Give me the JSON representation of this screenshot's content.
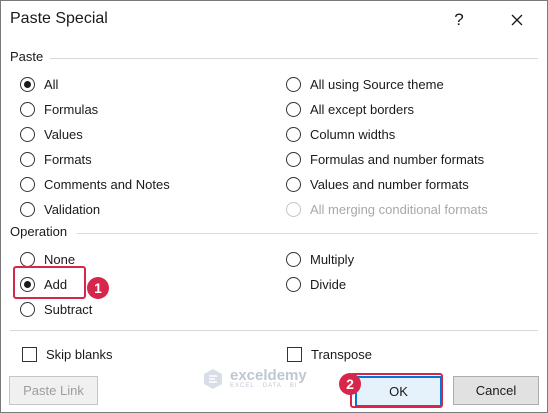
{
  "dialog": {
    "title": "Paste Special",
    "help_glyph": "?"
  },
  "paste": {
    "label": "Paste",
    "left": [
      {
        "label": "All",
        "checked": true
      },
      {
        "label": "Formulas"
      },
      {
        "label": "Values"
      },
      {
        "label": "Formats"
      },
      {
        "label": "Comments and Notes"
      },
      {
        "label": "Validation"
      }
    ],
    "right": [
      {
        "label": "All using Source theme"
      },
      {
        "label": "All except borders"
      },
      {
        "label": "Column widths"
      },
      {
        "label": "Formulas and number formats"
      },
      {
        "label": "Values and number formats"
      },
      {
        "label": "All merging conditional formats",
        "disabled": true
      }
    ]
  },
  "operation": {
    "label": "Operation",
    "left": [
      {
        "label": "None"
      },
      {
        "label": "Add",
        "checked": true
      },
      {
        "label": "Subtract"
      }
    ],
    "right": [
      {
        "label": "Multiply"
      },
      {
        "label": "Divide"
      }
    ]
  },
  "checkboxes": {
    "skip_blanks": "Skip blanks",
    "transpose": "Transpose"
  },
  "buttons": {
    "paste_link": "Paste Link",
    "ok": "OK",
    "cancel": "Cancel"
  },
  "annotations": {
    "step1": "1",
    "step2": "2"
  },
  "watermark": {
    "name": "exceldemy",
    "tagline": "EXCEL · DATA · BI"
  },
  "colors": {
    "highlight": "#d6264b",
    "focus": "#0078d7"
  }
}
